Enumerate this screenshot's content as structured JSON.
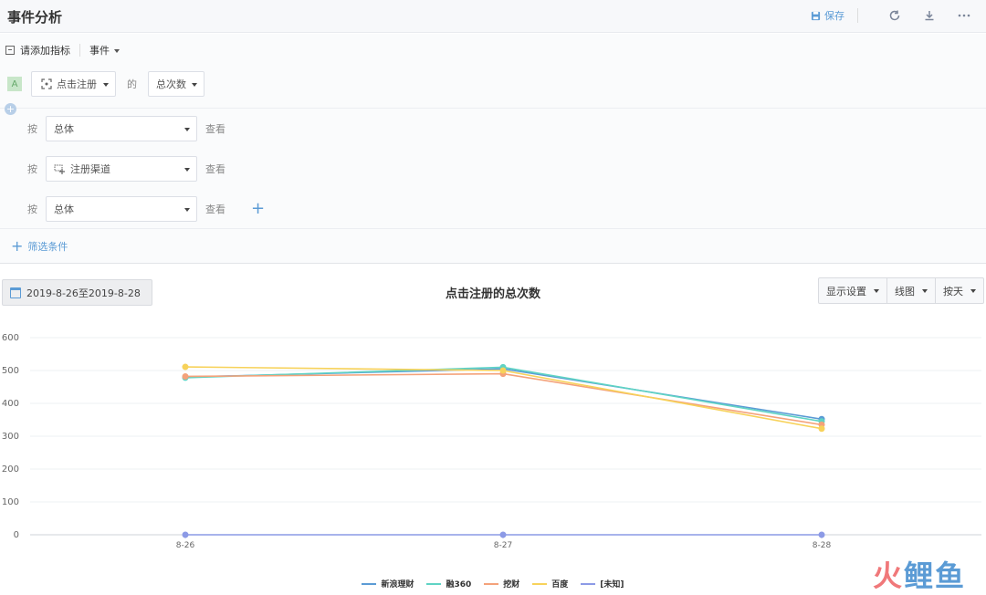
{
  "header": {
    "title": "事件分析",
    "save_label": "保存"
  },
  "metrics": {
    "add_label": "请添加指标",
    "type_label": "事件",
    "badge": "A",
    "event": "点击注册",
    "de": "的",
    "measure": "总次数"
  },
  "groups": [
    {
      "an": "按",
      "value": "总体",
      "chakan": "查看"
    },
    {
      "an": "按",
      "value": "注册渠道",
      "chakan": "查看"
    },
    {
      "an": "按",
      "value": "总体",
      "chakan": "查看"
    }
  ],
  "filter": {
    "add_label": "筛选条件"
  },
  "toolbar": {
    "date_range": "2019-8-26至2019-8-28",
    "display_settings": "显示设置",
    "chart_type": "线图",
    "granularity": "按天"
  },
  "chart_data": {
    "type": "line",
    "title": "点击注册的总次数",
    "categories": [
      "8-26",
      "8-27",
      "8-28"
    ],
    "ylim": [
      0,
      600
    ],
    "yticks": [
      0,
      100,
      200,
      300,
      400,
      500,
      600
    ],
    "grid": true,
    "legend_position": "bottom",
    "series": [
      {
        "name": "新浪理财",
        "color": "#5b9bd5",
        "values": [
          480,
          505,
          352
        ]
      },
      {
        "name": "融360",
        "color": "#5fd3c4",
        "values": [
          478,
          510,
          345
        ]
      },
      {
        "name": "挖财",
        "color": "#f4a27a",
        "values": [
          482,
          490,
          335
        ]
      },
      {
        "name": "百度",
        "color": "#f7d25a",
        "values": [
          511,
          500,
          323
        ]
      },
      {
        "name": "[未知]",
        "color": "#8c9ae6",
        "values": [
          0,
          0,
          0
        ]
      }
    ]
  },
  "watermark": {
    "part1": "火",
    "part2": "鲤鱼"
  }
}
